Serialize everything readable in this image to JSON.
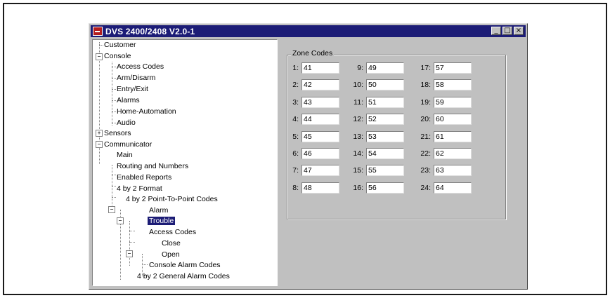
{
  "window": {
    "title": "DVS 2400/2408 V2.0-1"
  },
  "tree": {
    "customer": "Customer",
    "console": "Console",
    "console_access_codes": "Access Codes",
    "arm_disarm": "Arm/Disarm",
    "entry_exit": "Entry/Exit",
    "alarms": "Alarms",
    "home_automation": "Home-Automation",
    "audio": "Audio",
    "sensors": "Sensors",
    "communicator": "Communicator",
    "main": "Main",
    "routing": "Routing and Numbers",
    "enabled_reports": "Enabled Reports",
    "format_4by2": "4 by 2 Format",
    "ptp_codes": "4 by 2 Point-To-Point Codes",
    "alarm": "Alarm",
    "trouble": "Trouble",
    "access_codes": "Access Codes",
    "close": "Close",
    "open": "Open",
    "console_alarm_codes": "Console Alarm Codes",
    "general_alarm_codes": "4 by 2 General Alarm Codes"
  },
  "zone_codes": {
    "title": "Zone Codes",
    "zones": [
      {
        "label": "1:",
        "value": "41"
      },
      {
        "label": "2:",
        "value": "42"
      },
      {
        "label": "3:",
        "value": "43"
      },
      {
        "label": "4:",
        "value": "44"
      },
      {
        "label": "5:",
        "value": "45"
      },
      {
        "label": "6:",
        "value": "46"
      },
      {
        "label": "7:",
        "value": "47"
      },
      {
        "label": "8:",
        "value": "48"
      },
      {
        "label": "9:",
        "value": "49"
      },
      {
        "label": "10:",
        "value": "50"
      },
      {
        "label": "11:",
        "value": "51"
      },
      {
        "label": "12:",
        "value": "52"
      },
      {
        "label": "13:",
        "value": "53"
      },
      {
        "label": "14:",
        "value": "54"
      },
      {
        "label": "15:",
        "value": "55"
      },
      {
        "label": "16:",
        "value": "56"
      },
      {
        "label": "17:",
        "value": "57"
      },
      {
        "label": "18:",
        "value": "58"
      },
      {
        "label": "19:",
        "value": "59"
      },
      {
        "label": "20:",
        "value": "60"
      },
      {
        "label": "21:",
        "value": "61"
      },
      {
        "label": "22:",
        "value": "62"
      },
      {
        "label": "23:",
        "value": "63"
      },
      {
        "label": "24:",
        "value": "64"
      }
    ]
  }
}
